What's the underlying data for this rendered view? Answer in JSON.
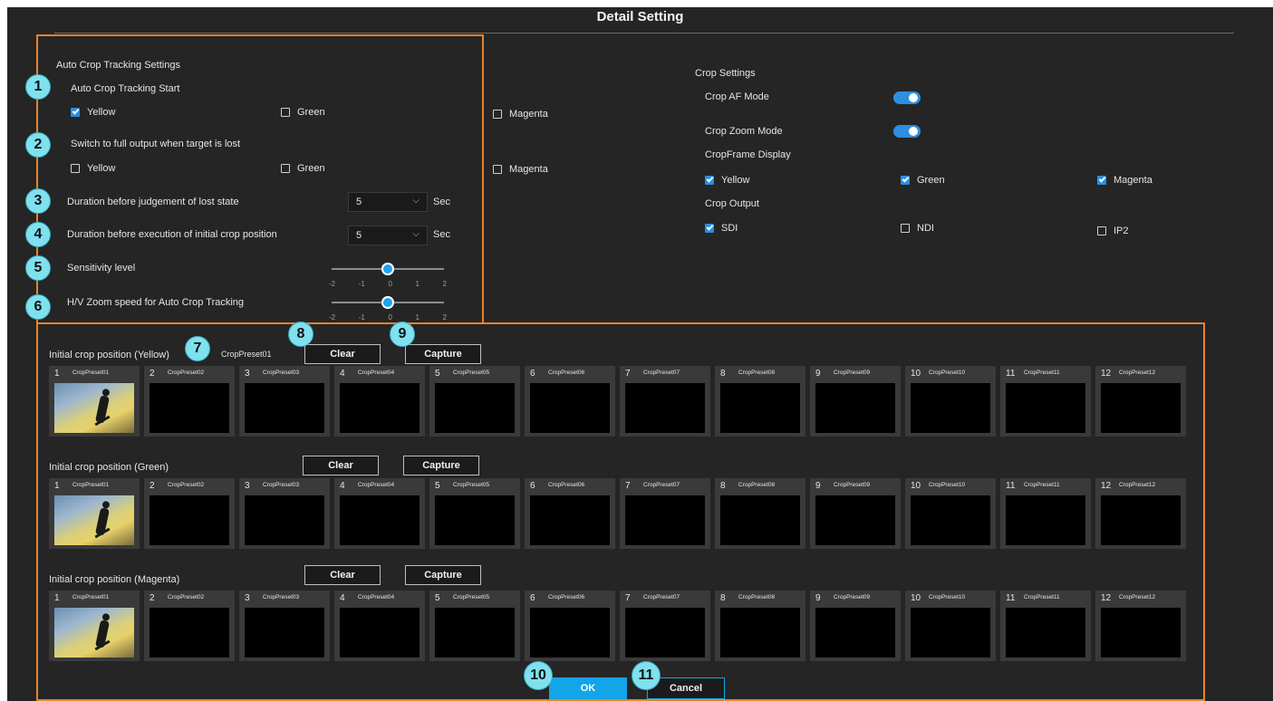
{
  "dialog": {
    "title": "Detail Setting"
  },
  "auto_crop": {
    "heading": "Auto Crop Tracking Settings",
    "start_label": "Auto Crop Tracking Start",
    "start_options": [
      {
        "label": "Yellow",
        "checked": true
      },
      {
        "label": "Green",
        "checked": false
      },
      {
        "label": "Magenta",
        "checked": false
      }
    ],
    "switch_label": "Switch to full output when target is lost",
    "switch_options": [
      {
        "label": "Yellow",
        "checked": false
      },
      {
        "label": "Green",
        "checked": false
      },
      {
        "label": "Magenta",
        "checked": false
      }
    ],
    "lost_duration_label": "Duration before judgement of lost state",
    "lost_duration_value": "5",
    "initial_duration_label": "Duration before execution of initial crop position",
    "initial_duration_value": "5",
    "unit_sec": "Sec",
    "sensitivity_label": "Sensitivity level",
    "sensitivity_value": 0,
    "zoom_speed_label": "H/V Zoom speed for Auto Crop Tracking",
    "zoom_speed_value": 0,
    "ticks": [
      "-2",
      "-1",
      "0",
      "1",
      "2"
    ]
  },
  "crop_settings": {
    "heading": "Crop Settings",
    "af_mode_label": "Crop AF Mode",
    "af_mode_on": true,
    "zoom_mode_label": "Crop Zoom Mode",
    "zoom_mode_on": true,
    "frame_display_label": "CropFrame Display",
    "frame_display": [
      {
        "label": "Yellow",
        "checked": true
      },
      {
        "label": "Green",
        "checked": true
      },
      {
        "label": "Magenta",
        "checked": true
      }
    ],
    "output_label": "Crop Output",
    "outputs": [
      {
        "label": "SDI",
        "checked": true
      },
      {
        "label": "NDI",
        "checked": false
      },
      {
        "label": "IP2",
        "checked": false
      }
    ]
  },
  "initial_positions": {
    "yellow": {
      "label": "Initial crop position (Yellow)",
      "selected": "CropPreset01"
    },
    "green": {
      "label": "Initial crop position (Green)"
    },
    "magenta": {
      "label": "Initial crop position (Magenta)"
    },
    "clear_label": "Clear",
    "capture_label": "Capture",
    "presets": [
      {
        "num": "1",
        "name": "CropPreset01"
      },
      {
        "num": "2",
        "name": "CropPreset02"
      },
      {
        "num": "3",
        "name": "CropPreset03"
      },
      {
        "num": "4",
        "name": "CropPreset04"
      },
      {
        "num": "5",
        "name": "CropPreset05"
      },
      {
        "num": "6",
        "name": "CropPreset06"
      },
      {
        "num": "7",
        "name": "CropPreset07"
      },
      {
        "num": "8",
        "name": "CropPreset08"
      },
      {
        "num": "9",
        "name": "CropPreset09"
      },
      {
        "num": "10",
        "name": "CropPreset10"
      },
      {
        "num": "11",
        "name": "CropPreset11"
      },
      {
        "num": "12",
        "name": "CropPreset12"
      }
    ]
  },
  "footer": {
    "ok_label": "OK",
    "cancel_label": "Cancel"
  },
  "callouts": [
    "1",
    "2",
    "3",
    "4",
    "5",
    "6",
    "7",
    "8",
    "9",
    "10",
    "11"
  ],
  "colors": {
    "accent": "#14a4e8",
    "highlight_frame": "#e8832e",
    "callout": "#7fe1ee",
    "panel": "#252525"
  }
}
